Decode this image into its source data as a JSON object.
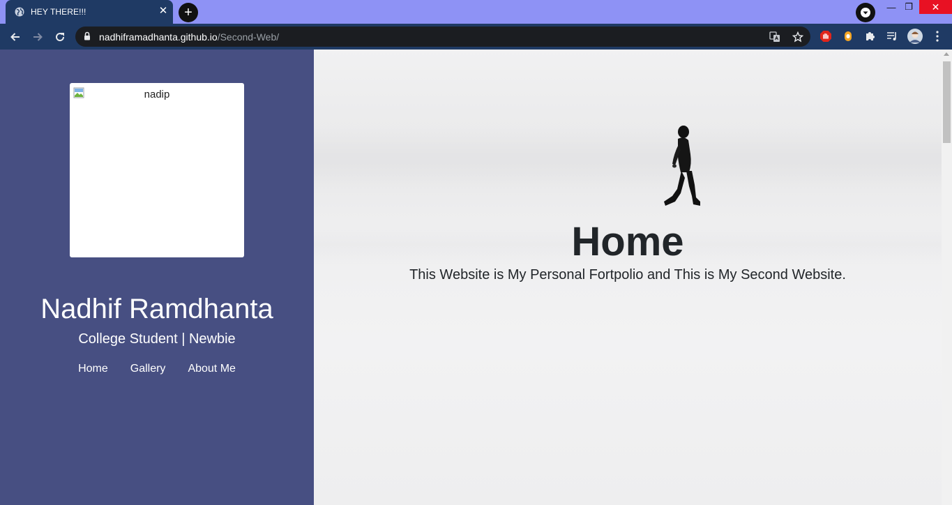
{
  "browser": {
    "tab_title": "HEY THERE!!!",
    "tab_close_glyph": "✕",
    "new_tab_glyph": "+",
    "url_host": "nadhiframadhanta.github.io",
    "url_path": "/Second-Web/",
    "window_controls": {
      "minimize": "—",
      "maximize": "❐",
      "close": "✕"
    },
    "colors": {
      "tab_strip": "#8e92f5",
      "toolbar": "#1f3a64",
      "omnibox": "#1b1d21"
    }
  },
  "sidebar": {
    "photo_alt": "nadip",
    "name": "Nadhif Ramdhanta",
    "subtitle": "College Student | Newbie",
    "nav": [
      "Home",
      "Gallery",
      "About Me"
    ],
    "background": "#474f82"
  },
  "hero": {
    "title": "Home",
    "text": "This Website is My Personal Fortpolio and This is My Second Website."
  }
}
